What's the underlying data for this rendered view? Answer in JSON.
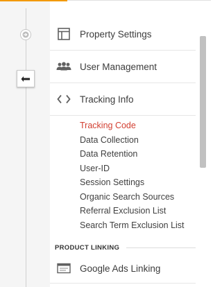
{
  "colors": {
    "accent": "#f29900",
    "active_link": "#d23f31"
  },
  "icons": {
    "forward": "arrow-right-circle-icon",
    "back": "arrow-left-icon",
    "property_settings": "window-layout-icon",
    "user_management": "people-group-icon",
    "tracking_info": "code-brackets-icon",
    "google_ads_linking": "ads-panel-icon"
  },
  "nav": {
    "items": [
      {
        "label": "Property Settings"
      },
      {
        "label": "User Management"
      },
      {
        "label": "Tracking Info"
      }
    ]
  },
  "tracking_info": {
    "subitems": [
      {
        "label": "Tracking Code",
        "active": true
      },
      {
        "label": "Data Collection"
      },
      {
        "label": "Data Retention"
      },
      {
        "label": "User-ID"
      },
      {
        "label": "Session Settings"
      },
      {
        "label": "Organic Search Sources"
      },
      {
        "label": "Referral Exclusion List"
      },
      {
        "label": "Search Term Exclusion List"
      }
    ]
  },
  "product_linking": {
    "heading": "PRODUCT LINKING",
    "items": [
      {
        "label": "Google Ads Linking"
      }
    ]
  }
}
